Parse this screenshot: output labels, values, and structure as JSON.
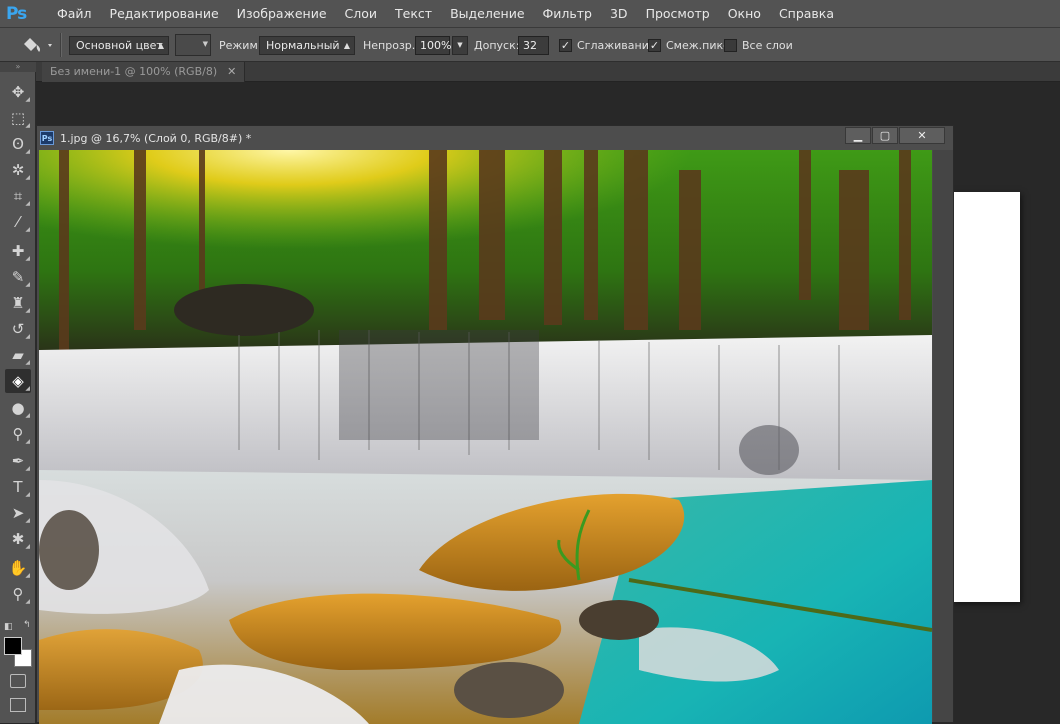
{
  "app": {
    "logo": "Ps"
  },
  "menu": [
    "Файл",
    "Редактирование",
    "Изображение",
    "Слои",
    "Текст",
    "Выделение",
    "Фильтр",
    "3D",
    "Просмотр",
    "Окно",
    "Справка"
  ],
  "options": {
    "fill_source": "Основной цвет",
    "mode_label": "Режим:",
    "mode_value": "Нормальный",
    "opacity_label": "Непрозр.:",
    "opacity_value": "100%",
    "tolerance_label": "Допуск:",
    "tolerance_value": "32",
    "antialias_label": "Сглаживание",
    "antialias_checked": true,
    "contiguous_label": "Смеж.пикс",
    "contiguous_checked": true,
    "all_layers_label": "Все слои",
    "all_layers_checked": false
  },
  "tabs": [
    {
      "label": "Без имени-1 @ 100% (RGB/8)"
    }
  ],
  "document": {
    "title": "1.jpg @ 16,7% (Слой 0, RGB/8#) *",
    "ps_icon": "Ps"
  },
  "tools": [
    {
      "name": "move-tool",
      "glyph": "✥"
    },
    {
      "name": "marquee-tool",
      "glyph": "⬚"
    },
    {
      "name": "lasso-tool",
      "glyph": "ʘ"
    },
    {
      "name": "magic-wand-tool",
      "glyph": "✲"
    },
    {
      "name": "crop-tool",
      "glyph": "⌗"
    },
    {
      "name": "eyedropper-tool",
      "glyph": "⁄"
    },
    {
      "name": "healing-brush-tool",
      "glyph": "✚"
    },
    {
      "name": "brush-tool",
      "glyph": "✎"
    },
    {
      "name": "clone-stamp-tool",
      "glyph": "♜"
    },
    {
      "name": "history-brush-tool",
      "glyph": "↺"
    },
    {
      "name": "eraser-tool",
      "glyph": "▰"
    },
    {
      "name": "paint-bucket-tool",
      "glyph": "◈",
      "active": true
    },
    {
      "name": "blur-tool",
      "glyph": "●"
    },
    {
      "name": "dodge-tool",
      "glyph": "⚲"
    },
    {
      "name": "pen-tool",
      "glyph": "✒"
    },
    {
      "name": "type-tool",
      "glyph": "T"
    },
    {
      "name": "path-selection-tool",
      "glyph": "➤"
    },
    {
      "name": "custom-shape-tool",
      "glyph": "✱"
    },
    {
      "name": "hand-tool",
      "glyph": "✋"
    },
    {
      "name": "zoom-tool",
      "glyph": "⚲"
    }
  ],
  "colors": {
    "foreground": "#000000",
    "background": "#ffffff",
    "ui_dark": "#282828",
    "ui_panel": "#535353"
  }
}
